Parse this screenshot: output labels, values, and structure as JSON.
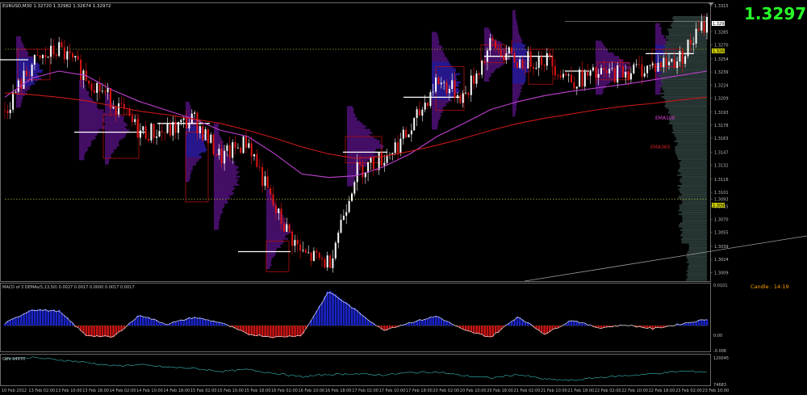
{
  "colors": {
    "background": "#000000",
    "panel_border": "#6a6a6a",
    "bull": "#ffffff",
    "bear": "#e01414",
    "ema100": "#c040d0",
    "ema365": "#c81818",
    "profile": "#4a1070",
    "profile_blue": "#2a1a9a",
    "volume_profile": "#2a3a38",
    "level_line": "#9aa82a",
    "hline": "#ffffff",
    "box": "#b01010",
    "macd_pos": "#1a24c8",
    "macd_neg": "#c81414",
    "macd_line": "#ffffff",
    "obv": "#30a0a0",
    "price_big": "#22ff22",
    "candle_timer": "#ffa000",
    "price_label_bg": "#c8c800"
  },
  "header": {
    "symbol_info": "EURUSD,M30  1.32720 1.32982 1.32674 1.32972"
  },
  "price_big": "1.3297",
  "ema_labels": {
    "ema100": "EMA100",
    "ema365": "EMA365"
  },
  "macd_header": "MACD of 3 DEMAs(5,13,50) 0.0027 0.0017 0.0000 0.0017 0.0017",
  "candle_timer": "Candle : 14:19",
  "obv_header": "OBV 94470",
  "price_labels": [
    "1.3315",
    "1.3285",
    "1.3270",
    "1.3254",
    "1.3239",
    "1.3224",
    "1.3209",
    "1.3193",
    "1.3178",
    "1.3163",
    "1.3147",
    "1.3132",
    "1.3116",
    "1.3101",
    "1.3093",
    "1.3085",
    "1.3070",
    "1.3055",
    "1.3039",
    "1.3024",
    "1.3009"
  ],
  "price_tag_current": "1.3297",
  "price_tag_upper": "1.3265",
  "price_tag_lower": "1.3093",
  "macd_ticks": [
    "0.0101",
    "0.00",
    "-0.006"
  ],
  "obv_ticks": [
    "120045",
    "74683"
  ],
  "date_labels": [
    "10 Feb 2012",
    "13 Feb 02:00",
    "13 Feb 10:00",
    "13 Feb 18:00",
    "14 Feb 02:00",
    "14 Feb 10:00",
    "14 Feb 18:00",
    "15 Feb 02:00",
    "15 Feb 10:00",
    "15 Feb 18:00",
    "16 Feb 02:00",
    "16 Feb 10:00",
    "16 Feb 18:00",
    "17 Feb 02:00",
    "17 Feb 10:00",
    "17 Feb 18:00",
    "20 Feb 02:00",
    "20 Feb 10:00",
    "20 Feb 18:00",
    "21 Feb 02:00",
    "21 Feb 10:00",
    "21 Feb 18:00",
    "22 Feb 02:00",
    "22 Feb 10:00",
    "22 Feb 18:00",
    "23 Feb 02:00",
    "23 Feb 10:00"
  ],
  "chart_data": [
    {
      "type": "line",
      "note": "EURUSD M30 candlestick price with EMA100 and EMA365",
      "ylim": [
        1.3001,
        1.3316
      ],
      "levels": [
        1.3265,
        1.3093
      ],
      "x": [
        "10 Feb 2012",
        "13 Feb 02:00",
        "13 Feb 10:00",
        "13 Feb 18:00",
        "14 Feb 02:00",
        "14 Feb 10:00",
        "14 Feb 18:00",
        "15 Feb 02:00",
        "15 Feb 10:00",
        "15 Feb 18:00",
        "16 Feb 02:00",
        "16 Feb 10:00",
        "16 Feb 18:00",
        "17 Feb 02:00",
        "17 Feb 10:00",
        "17 Feb 18:00",
        "20 Feb 02:00",
        "20 Feb 10:00",
        "20 Feb 18:00",
        "21 Feb 02:00",
        "21 Feb 10:00",
        "21 Feb 18:00",
        "22 Feb 02:00",
        "22 Feb 10:00",
        "22 Feb 18:00",
        "23 Feb 02:00",
        "23 Feb 10:00"
      ],
      "series": [
        {
          "values": [
            1.3195,
            1.3247,
            1.3265,
            1.3235,
            1.3205,
            1.317,
            1.317,
            1.3185,
            1.314,
            1.316,
            1.308,
            1.303,
            1.302,
            1.3125,
            1.314,
            1.317,
            1.323,
            1.321,
            1.327,
            1.325,
            1.3255,
            1.323,
            1.3235,
            1.324,
            1.3245,
            1.3255,
            1.3297
          ]
        },
        {
          "name": "EMA100",
          "values": [
            1.321,
            1.3232,
            1.324,
            1.3235,
            1.3218,
            1.3205,
            1.3195,
            1.3185,
            1.3172,
            1.3165,
            1.3145,
            1.3122,
            1.3118,
            1.312,
            1.313,
            1.3145,
            1.3165,
            1.318,
            1.3196,
            1.3205,
            1.3212,
            1.3217,
            1.3221,
            1.3225,
            1.323,
            1.3235,
            1.324
          ]
        },
        {
          "name": "EMA365",
          "values": [
            1.3215,
            1.3213,
            1.321,
            1.3206,
            1.32,
            1.3194,
            1.319,
            1.3185,
            1.318,
            1.3172,
            1.3163,
            1.3153,
            1.3145,
            1.314,
            1.3142,
            1.3148,
            1.3155,
            1.3163,
            1.3172,
            1.318,
            1.3186,
            1.3191,
            1.3196,
            1.32,
            1.3203,
            1.3207,
            1.321
          ]
        }
      ]
    },
    {
      "type": "bar",
      "note": "MACD of 3 DEMAs(5,13,50) histogram",
      "ylim": [
        -0.006,
        0.0101
      ],
      "x": [
        "10 Feb 2012",
        "13 Feb 02:00",
        "13 Feb 10:00",
        "13 Feb 18:00",
        "14 Feb 02:00",
        "14 Feb 10:00",
        "14 Feb 18:00",
        "15 Feb 02:00",
        "15 Feb 10:00",
        "15 Feb 18:00",
        "16 Feb 02:00",
        "16 Feb 10:00",
        "16 Feb 18:00",
        "17 Feb 02:00",
        "17 Feb 10:00",
        "17 Feb 18:00",
        "20 Feb 02:00",
        "20 Feb 10:00",
        "20 Feb 18:00",
        "21 Feb 02:00",
        "21 Feb 10:00",
        "21 Feb 18:00",
        "22 Feb 02:00",
        "22 Feb 10:00",
        "22 Feb 18:00",
        "23 Feb 02:00",
        "23 Feb 10:00"
      ],
      "values": [
        0.0006,
        0.0042,
        0.0038,
        -0.0025,
        -0.003,
        0.0028,
        0.0004,
        0.0022,
        0.0008,
        -0.0022,
        -0.003,
        -0.0025,
        0.009,
        0.004,
        -0.0012,
        0.0008,
        0.0025,
        -0.0012,
        -0.003,
        0.0024,
        -0.0022,
        0.0015,
        -0.0006,
        0.0002,
        -0.0008,
        0.0004,
        0.0017
      ]
    },
    {
      "type": "line",
      "note": "OBV",
      "ylim": [
        74683,
        120045
      ],
      "x": [
        "10 Feb 2012",
        "13 Feb 02:00",
        "13 Feb 10:00",
        "13 Feb 18:00",
        "14 Feb 02:00",
        "14 Feb 10:00",
        "14 Feb 18:00",
        "15 Feb 02:00",
        "15 Feb 10:00",
        "15 Feb 18:00",
        "16 Feb 02:00",
        "16 Feb 10:00",
        "16 Feb 18:00",
        "17 Feb 02:00",
        "17 Feb 10:00",
        "17 Feb 18:00",
        "20 Feb 02:00",
        "20 Feb 10:00",
        "20 Feb 18:00",
        "21 Feb 02:00",
        "21 Feb 10:00",
        "21 Feb 18:00",
        "22 Feb 02:00",
        "22 Feb 10:00",
        "22 Feb 18:00",
        "23 Feb 02:00",
        "23 Feb 10:00"
      ],
      "values": [
        116000,
        118000,
        114000,
        110000,
        104000,
        106000,
        102000,
        100000,
        95000,
        98000,
        92000,
        86000,
        90000,
        91000,
        89000,
        93000,
        94000,
        88000,
        84000,
        90000,
        82000,
        80000,
        85000,
        88000,
        91000,
        95000,
        94470
      ]
    }
  ]
}
